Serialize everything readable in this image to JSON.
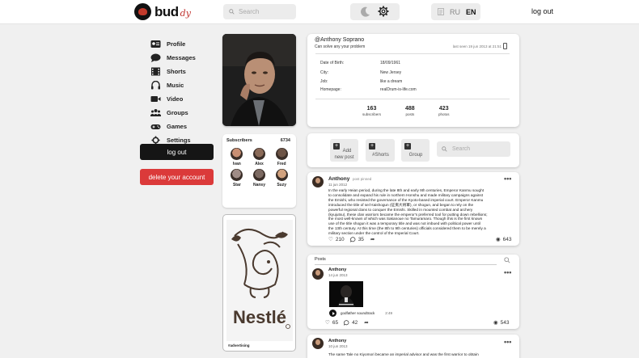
{
  "header": {
    "logo_text": "bud",
    "logo_suffix": "dy",
    "search_placeholder": "Search",
    "lang_ru": "RU",
    "lang_en": "EN",
    "logout": "log out"
  },
  "sidebar": {
    "items": [
      {
        "label": "Profile",
        "icon": "profile-icon"
      },
      {
        "label": "Messages",
        "icon": "messages-icon"
      },
      {
        "label": "Shorts",
        "icon": "shorts-icon"
      },
      {
        "label": "Music",
        "icon": "music-icon"
      },
      {
        "label": "Video",
        "icon": "video-icon"
      },
      {
        "label": "Groups",
        "icon": "groups-icon"
      },
      {
        "label": "Games",
        "icon": "games-icon"
      },
      {
        "label": "Settings",
        "icon": "settings-icon"
      }
    ],
    "logout_label": "log out",
    "delete_label": "delete your account"
  },
  "subscribers": {
    "label": "Subscribers",
    "count": "6734",
    "people": [
      {
        "name": "Ivan",
        "color": "#c98f73"
      },
      {
        "name": "Alex",
        "color": "#8a6a58"
      },
      {
        "name": "Fred",
        "color": "#6d5446"
      },
      {
        "name": "Star",
        "color": "#a08c86"
      },
      {
        "name": "Nansy",
        "color": "#7c6a62"
      },
      {
        "name": "Suzy",
        "color": "#d2a27e"
      }
    ]
  },
  "ad": {
    "tag": "#advertising",
    "brand": "Nestlé"
  },
  "profile": {
    "name": "@Anthony Soprano",
    "status": "Can solve any your problem",
    "last_seen": "last seen 19 jun 2013 at 21:51",
    "rows": [
      {
        "label": "Date of Birth:",
        "value": "18/09/1961"
      },
      {
        "label": "City:",
        "value": "New Jersey"
      },
      {
        "label": "Job:",
        "value": "like a dream"
      },
      {
        "label": "Homepage:",
        "value": "realDrum-is-life.com"
      }
    ],
    "stats": [
      {
        "num": "163",
        "label": "subscribers"
      },
      {
        "num": "488",
        "label": "posts"
      },
      {
        "num": "423",
        "label": "photos"
      }
    ]
  },
  "actions": {
    "add_post_1": "Add",
    "add_post_2": "new post",
    "shorts": "#Shorts",
    "group": "Group",
    "search_placeholder": "Search"
  },
  "pinned_post": {
    "author": "Anthony",
    "pinned": "post pinned",
    "date": "11 jun 2012",
    "text_1": "In the early Heian period, during the late 8th and early 9th centuries, Emperor Kanmu sought",
    "text_2": "to consolidate and expand his rule in northern Honshu and made military campaigns against",
    "text_3": "the Emishi, who resisted the governance of the Kyoto-based imperial court. Emperor Kanmu",
    "text_4": "introduced the title of sei'i-taishogun (征夷大将軍), or shogun, and began to rely on the",
    "text_5": "powerful regional clans to conquer the Emishi. Skilled in mounted combat and archery",
    "text_6": "(kyujutsu), these clan warriors became the emperor's preferred tool for putting down rebellions;",
    "text_7": "the most well-known of which was Sakanoue no Tamuramaro. Though this is the first known",
    "text_8": "use of the title shogun it was a temporary title and was not imbued with political power until",
    "text_9": "the 13th century. At this time (the 8th to 9th centuries) officials considered them to be merely a",
    "text_10": "military section under the control of the Imperial Court.",
    "likes": "210",
    "comments": "35",
    "views": "643"
  },
  "posts_section": {
    "title": "Posts",
    "post1": {
      "author": "Anthony",
      "date": "14 jun 2013",
      "track": "godfather soundtrack",
      "duration": "2:49",
      "likes": "65",
      "comments": "42",
      "views": "543"
    },
    "post2": {
      "author": "Anthony",
      "date": "10 jun 2013",
      "text": "The same Tale no Kiyomori became an imperial advisor and was the first warrior to obtain"
    }
  }
}
